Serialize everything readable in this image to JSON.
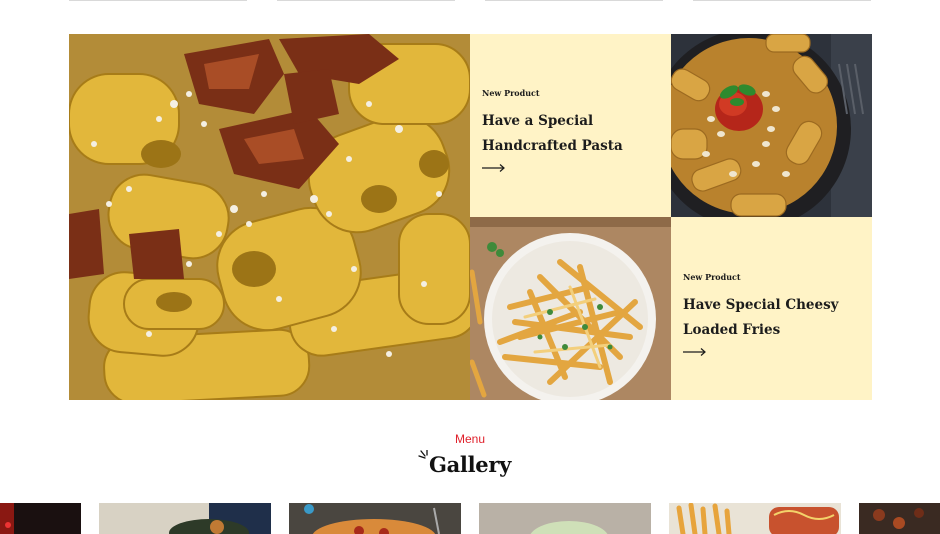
{
  "promos": [
    {
      "eyebrow": "New Product",
      "title": "Have a Special Handcrafted Pasta",
      "arrow_icon": "arrow-right-icon",
      "background": "#fff3c6"
    },
    {
      "eyebrow": "New Product",
      "title": "Have Special Cheesy Loaded Fries",
      "arrow_icon": "arrow-right-icon",
      "background": "#fff3c6"
    }
  ],
  "gallery": {
    "kicker": "Menu",
    "title": "Gallery",
    "kicker_color": "#e01f2a"
  }
}
